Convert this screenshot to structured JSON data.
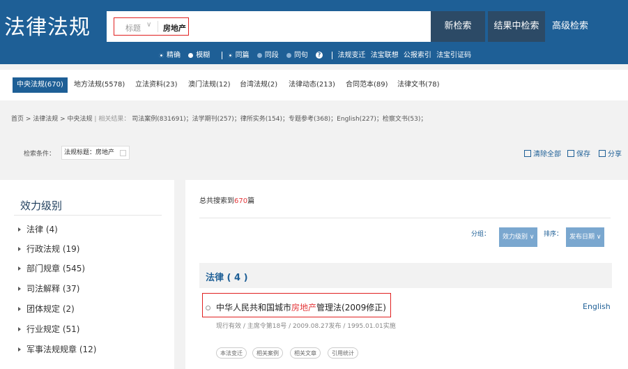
{
  "header": {
    "logo": "法律法规",
    "search": {
      "field": "标题",
      "value": "房地产"
    },
    "buttons": {
      "new_search": "新检索",
      "search_in_results": "结果中检索",
      "advanced": "高级检索"
    },
    "options": {
      "exact": "精确",
      "fuzzy": "模糊",
      "same_article": "同篇",
      "same_paragraph": "同段",
      "same_sentence": "同句",
      "links": [
        "法规变迁",
        "法宝联想",
        "公报索引",
        "法宝引证码"
      ]
    }
  },
  "tabs": [
    {
      "label": "中央法规(670)"
    },
    {
      "label": "地方法规(5578)"
    },
    {
      "label": "立法资料(23)"
    },
    {
      "label": "澳门法规(12)"
    },
    {
      "label": "台湾法规(2)"
    },
    {
      "label": "法律动态(213)"
    },
    {
      "label": "合同范本(89)"
    },
    {
      "label": "法律文书(78)"
    }
  ],
  "breadcrumb": {
    "path": "首页 > 法律法规 > 中央法规",
    "related_label": "相关结果：",
    "related": "司法案例(831691)；法学期刊(257)；律所实务(154)；专题参考(368)；English(227)；检察文书(53)；"
  },
  "conditions": {
    "label": "检索条件：",
    "chip": "法规标题：房地产",
    "tools": {
      "clear": "清除全部",
      "save": "保存",
      "share": "分享"
    }
  },
  "sidebar": {
    "title": "效力级别",
    "items": [
      {
        "label": "法律 (4)"
      },
      {
        "label": "行政法规 (19)"
      },
      {
        "label": "部门规章 (545)"
      },
      {
        "label": "司法解释 (37)"
      },
      {
        "label": "团体规定 (2)"
      },
      {
        "label": "行业规定 (51)"
      },
      {
        "label": "军事法规规章 (12)"
      }
    ]
  },
  "results": {
    "total_prefix": "总共搜索到",
    "total_count": "670",
    "total_suffix": "篇",
    "group_label": "分组：",
    "group_value": "效力级别",
    "sort_label": "排序：",
    "sort_value": "发布日期",
    "group_title": "法律 ( 4 )",
    "item": {
      "title_before": "中华人民共和国城市",
      "title_highlight": "房地产",
      "title_after": "管理法(2009修正)",
      "english": "English",
      "meta": "现行有效 / 主席令第18号 / 2009.08.27发布 / 1995.01.01实施",
      "tags": [
        "本法变迁",
        "相关案例",
        "相关文章",
        "引用统计"
      ]
    }
  },
  "colors": {
    "brand": "#1e5f96",
    "highlight": "#e4393c",
    "border_mark": "#e02020"
  }
}
